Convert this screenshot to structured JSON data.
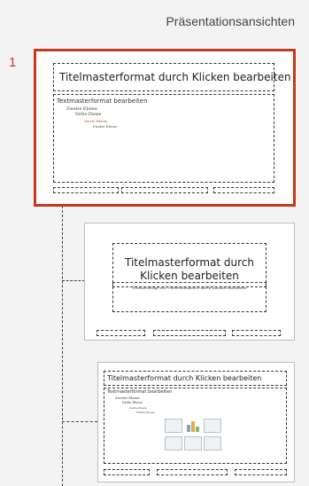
{
  "pane": {
    "title": "Präsentationsansichten"
  },
  "thumbnails": {
    "number": "1",
    "master": {
      "title": "Titelmasterformat durch Klicken bearbeiten",
      "levels": [
        "Textmasterformat bearbeiten",
        "Zweite Ebene",
        "Dritte Ebene",
        "Vierte Ebene",
        "Fünfte Ebene"
      ]
    },
    "title_layout": {
      "title_line1": "Titelmasterformat durch",
      "title_line2": "Klicken bearbeiten",
      "subtitle": "Formatvorlage des Untertitelmasters durch Klicken bearbeiten"
    },
    "content_layout": {
      "title": "Titelmasterformat durch Klicken bearbeiten",
      "levels": [
        "Textmasterformat bearbeiten",
        "Zweite Ebene",
        "Dritte Ebene",
        "Vierte Ebene",
        "Fünfte Ebene"
      ]
    }
  }
}
